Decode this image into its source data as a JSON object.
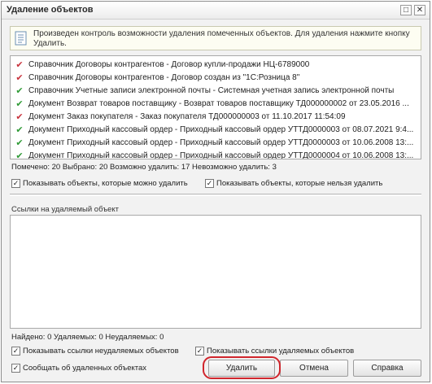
{
  "window": {
    "title": "Удаление объектов",
    "maximize_symbol": "□",
    "close_symbol": "✕"
  },
  "info": {
    "text": "Произведен контроль возможности удаления помеченных объектов. Для удаления нажмите кнопку Удалить."
  },
  "objects": [
    {
      "status": "delete",
      "text": "Справочник Договоры контрагентов - Договор купли-продажи НЦ-6789000"
    },
    {
      "status": "delete",
      "text": "Справочник Договоры контрагентов - Договор создан из \"1С:Розница 8\""
    },
    {
      "status": "ok",
      "text": "Справочник Учетные записи электронной почты - Системная учетная запись электронной почты"
    },
    {
      "status": "ok",
      "text": "Документ Возврат товаров поставщику - Возврат товаров поставщику ТД000000002 от 23.05.2016 ..."
    },
    {
      "status": "delete",
      "text": "Документ Заказ покупателя - Заказ покупателя ТД000000003 от 11.10.2017 11:54:09"
    },
    {
      "status": "ok",
      "text": "Документ Приходный кассовый ордер - Приходный кассовый ордер УТТД0000003 от 08.07.2021 9:4..."
    },
    {
      "status": "ok",
      "text": "Документ Приходный кассовый ордер - Приходный кассовый ордер УТТД0000003 от 10.06.2008 13:..."
    },
    {
      "status": "ok",
      "text": "Документ Приходный кассовый ордер - Приходный кассовый ордер УТТД0000004 от 10.06.2008 13:..."
    }
  ],
  "stats": "Помечено: 20  Выбрано: 20  Возможно удалить: 17  Невозможно удалить: 3",
  "checkboxes": {
    "show_deletable": {
      "label": "Показывать объекты, которые можно удалить",
      "checked": "✓"
    },
    "show_undeletable": {
      "label": "Показывать объекты, которые нельзя удалить",
      "checked": "✓"
    },
    "show_refs_undeletable": {
      "label": "Показывать ссылки неудаляемых объектов",
      "checked": "✓"
    },
    "show_refs_deletable": {
      "label": "Показывать ссылки удаляемых объектов",
      "checked": "✓"
    },
    "report_deleted": {
      "label": "Сообщать об удаленных объектах",
      "checked": "✓"
    }
  },
  "refs": {
    "label": "Ссылки на удаляемый объект"
  },
  "found": "Найдено: 0  Удаляемых: 0  Неудаляемых: 0",
  "buttons": {
    "delete": "Удалить",
    "cancel": "Отмена",
    "help": "Справка"
  },
  "colors": {
    "delete_mark": "#c8323c",
    "ok_mark": "#2e9a35",
    "highlight": "#d0262d"
  }
}
